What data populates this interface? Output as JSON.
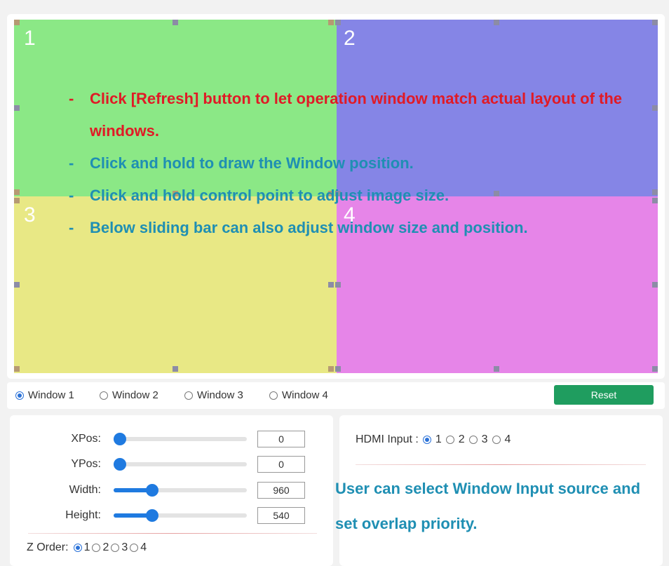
{
  "quadrants": [
    {
      "label": "1",
      "color": "#8be886"
    },
    {
      "label": "2",
      "color": "#8585e6"
    },
    {
      "label": "3",
      "color": "#e8e885"
    },
    {
      "label": "4",
      "color": "#e685e8"
    }
  ],
  "instructions": {
    "line1_dash": "-",
    "line1": "Click [Refresh] button to let operation window match actual layout of the windows.",
    "line2_dash": "-",
    "line2": "Click and hold to draw the Window position.",
    "line3_dash": "-",
    "line3": "Click and hold control point to adjust image size.",
    "line4_dash": "-",
    "line4": "Below sliding bar can also adjust window size and position.",
    "red_color": "#e01a26",
    "teal_color": "#1f8fb3"
  },
  "window_select": {
    "options": [
      "Window 1",
      "Window 2",
      "Window 3",
      "Window 4"
    ],
    "selected": "Window 1"
  },
  "reset_label": "Reset",
  "sliders": {
    "xpos": {
      "label": "XPos:",
      "value": "0",
      "fraction": 0.0
    },
    "ypos": {
      "label": "YPos:",
      "value": "0",
      "fraction": 0.0
    },
    "width": {
      "label": "Width:",
      "value": "960",
      "fraction": 0.27
    },
    "height": {
      "label": "Height:",
      "value": "540",
      "fraction": 0.27
    }
  },
  "z_order": {
    "label": "Z Order:",
    "options": [
      "1",
      "2",
      "3",
      "4"
    ],
    "selected": "1"
  },
  "hdmi_input": {
    "label": "HDMI Input :",
    "options": [
      "1",
      "2",
      "3",
      "4"
    ],
    "selected": "1"
  },
  "right_note": "User can select Window Input source and set overlap priority.",
  "accent_color": "#1f7ae0",
  "reset_color": "#1f9d5f"
}
